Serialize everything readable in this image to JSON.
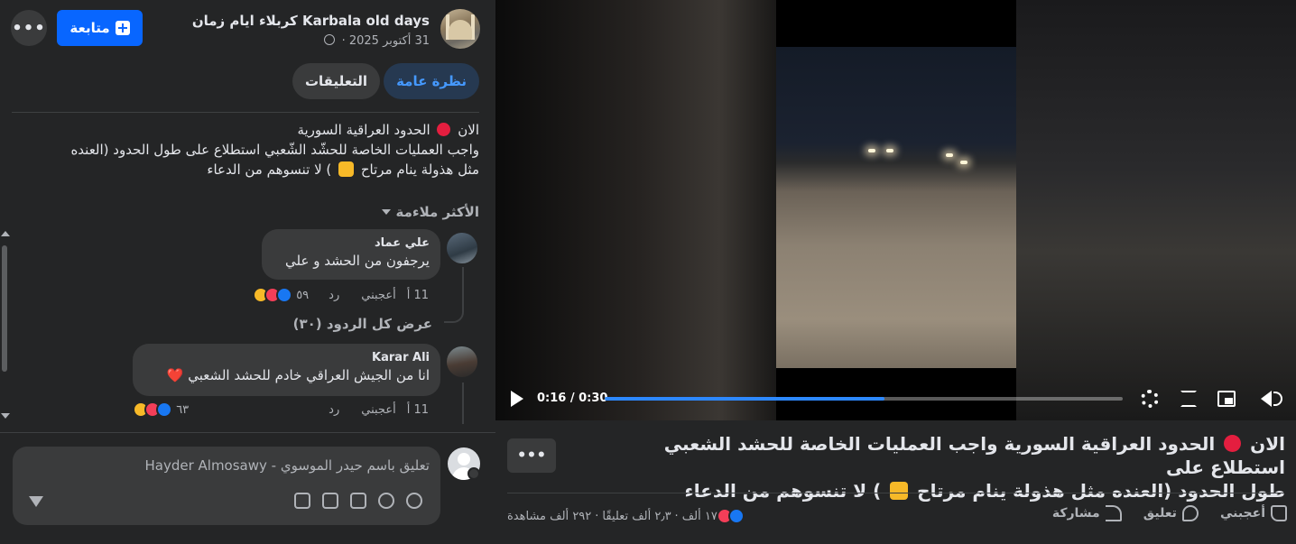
{
  "post": {
    "page_name": "كربلاء ايام زمان Karbala old days",
    "date": "31 أكتوبر 2025 ·",
    "follow_label": "متابعة",
    "more_label": "•••",
    "tabs": [
      {
        "label": "نظرة عامة",
        "active": true
      },
      {
        "label": "التعليقات",
        "active": false
      }
    ],
    "text_line1_a": "الان",
    "text_line1_b": "الحدود العراقية السورية",
    "text_line2": "واجب العمليات الخاصة للحشّد الشّعبي استطلاع على طول الحدود (العنده",
    "text_line3_a": "مثل هذولة ينام مرتاح",
    "text_line3_b": ") لا تنسوهم من الدعاء",
    "sort_label": "الأكثر ملاءمة"
  },
  "comments": [
    {
      "name": "علي عماد",
      "text": "يرجفون من الحشد و علي",
      "time": "11 أ",
      "like_label": "أعجبني",
      "reply_label": "رد",
      "reaction_count": "٥٩",
      "view_replies": "عرض كل الردود (٣٠)"
    },
    {
      "name": "Karar Ali",
      "text": "انا من الجيش العراقي خادم للحشد الشعبي ❤️",
      "time": "11 أ",
      "like_label": "أعجبني",
      "reply_label": "رد",
      "reaction_count": "٦٣"
    }
  ],
  "composer": {
    "placeholder": "تعليق باسم حيدر الموسوي - Hayder Almosawy"
  },
  "video": {
    "time": "0:16 / 0:30",
    "progress": 0.54
  },
  "caption": {
    "line1_a": "الان",
    "line1_b": "الحدود العراقية السورية واجب العمليات الخاصة للحشد الشعبي استطلاع على",
    "line2_a": "طول الحدود (العنده مثل هذولة ينام مرتاح",
    "line2_b": ") لا تنسوهم من الدعاء",
    "more_label": "•••",
    "reactions_count": "١٧ ألف",
    "comments_count": "٢٫٣ ألف تعليقًا",
    "views_count": "٢٩٢ ألف مشاهدة",
    "separator": "·",
    "actions": {
      "like": "أعجبني",
      "comment": "تعليق",
      "share": "مشاركة"
    }
  },
  "colors": {
    "accent": "#0866ff",
    "panel": "#242526",
    "bubble": "#3a3b3c"
  }
}
